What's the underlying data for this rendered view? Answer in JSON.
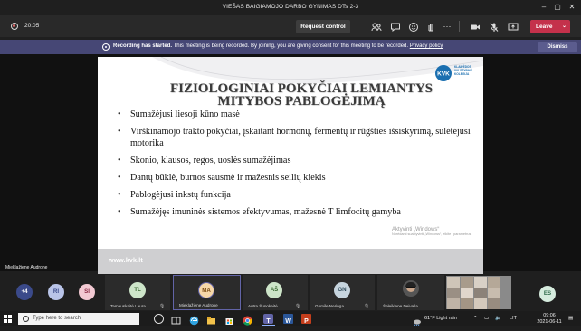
{
  "window": {
    "title": "VIEŠAS BAIGIAMOJO DARBO GYNIMAS DTs 2-3",
    "controls": [
      "minimize",
      "maximize",
      "close"
    ]
  },
  "toolbar": {
    "timer": "20:05",
    "request_control": "Request control",
    "leave": "Leave",
    "icons": [
      "people-icon",
      "chat-icon",
      "reactions-icon",
      "raise-hand-icon",
      "more-icon",
      "camera-icon",
      "mic-icon",
      "share-icon"
    ]
  },
  "banner": {
    "bold": "Recording has started.",
    "text": " This meeting is being recorded. By joining, you are giving consent for this meeting to be recorded.",
    "link": "Privacy policy",
    "dismiss": "Dismiss"
  },
  "slide": {
    "title_line1": "FIZIOLOGINIAI POKYČIAI LEMIANTYS",
    "title_line2": "MITYBOS PABLOGĖJIMĄ",
    "logo_text": "KVK",
    "logo_caption": [
      "KLAIPĖDOS",
      "VALSTYBINĖ",
      "KOLEGIJA"
    ],
    "bullets": [
      "Sumažėjusi liesoji kūno masė",
      "Virškinamojo trakto pokyčiai, įskaitant hormonų, fermentų ir rūgšties išsiskyrimą, sulėtėjusi motorika",
      "Skonio, klausos, regos, uoslės sumažėjimas",
      "Dantų būklė, burnos sausmė ir mažesnis seilių kiekis",
      "Pablogėjusi inkstų funkcija",
      "Sumažėjęs imuninės sistemos efektyvumas, mažesnė T limfocitų gamyba"
    ],
    "website": "www.kvk.lt",
    "watermark_title": "Aktyvinti „Windows“",
    "watermark_sub": "Norėdami suaktyvinti „Windows“, eikite į parametrus."
  },
  "speaker": "Mieklažiene Audrone",
  "participants": {
    "overflow": "+4",
    "avatars": [
      {
        "initials": "RI",
        "bg": "#b9c4e8",
        "fg": "#3a4a8a"
      },
      {
        "initials": "SI",
        "bg": "#f2c9d2",
        "fg": "#8a2a44"
      }
    ],
    "tiles": [
      {
        "initials": "TL",
        "name": "Tamauskaitė Laura",
        "bg": "#cde5c9",
        "fg": "#3c6b35"
      },
      {
        "initials": "MA",
        "name": "Mieklažiene Audrone",
        "bg": "#f6d7a8",
        "fg": "#7a4a10"
      },
      {
        "initials": "AŠ",
        "name": "Autra Šunokaitė",
        "bg": "#cde5c9",
        "fg": "#3c6b35"
      },
      {
        "initials": "GN",
        "name": "Gomile Neringa",
        "bg": "#c6d4de",
        "fg": "#2f4a5a"
      },
      {
        "initials": "",
        "name": "Šeleikiene Deivalla",
        "bg": "#2b2b2b",
        "fg": "#ffffff"
      }
    ],
    "last": {
      "initials": "ES",
      "bg": "#d6ecde",
      "fg": "#2f6b4b"
    }
  },
  "taskbar": {
    "search_placeholder": "Type here to search",
    "weather": "61°F  Light rain",
    "language": "LIT",
    "time": "09:06",
    "date": "2021-06-11"
  },
  "colors": {
    "banner": "#464775",
    "leave": "#c4314b",
    "kvk_blue": "#1a6fb0"
  }
}
